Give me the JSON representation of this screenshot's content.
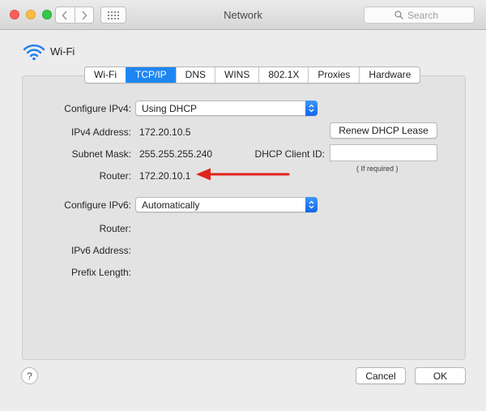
{
  "window": {
    "title": "Network"
  },
  "toolbar": {
    "search_placeholder": "Search"
  },
  "header": {
    "device_name": "Wi-Fi"
  },
  "tabs": [
    {
      "label": "Wi-Fi",
      "active": false
    },
    {
      "label": "TCP/IP",
      "active": true
    },
    {
      "label": "DNS",
      "active": false
    },
    {
      "label": "WINS",
      "active": false
    },
    {
      "label": "802.1X",
      "active": false
    },
    {
      "label": "Proxies",
      "active": false
    },
    {
      "label": "Hardware",
      "active": false
    }
  ],
  "ipv4": {
    "configure_label": "Configure IPv4:",
    "configure_value": "Using DHCP",
    "address_label": "IPv4 Address:",
    "address_value": "172.20.10.5",
    "subnet_label": "Subnet Mask:",
    "subnet_value": "255.255.255.240",
    "router_label": "Router:",
    "router_value": "172.20.10.1",
    "renew_button": "Renew DHCP Lease",
    "client_id_label": "DHCP Client ID:",
    "client_id_value": "",
    "client_id_hint": "( If required )"
  },
  "ipv6": {
    "configure_label": "Configure IPv6:",
    "configure_value": "Automatically",
    "router_label": "Router:",
    "address_label": "IPv6 Address:",
    "prefix_label": "Prefix Length:"
  },
  "footer": {
    "help_label": "?",
    "cancel_button": "Cancel",
    "ok_button": "OK"
  },
  "colors": {
    "accent": "#1e86f3",
    "annotation_arrow": "#e0231d"
  },
  "icons": [
    "wifi-icon",
    "search-icon",
    "chevron-left-icon",
    "chevron-right-icon",
    "grid-icon",
    "popup-arrows-icon",
    "red-arrow-annotation"
  ]
}
